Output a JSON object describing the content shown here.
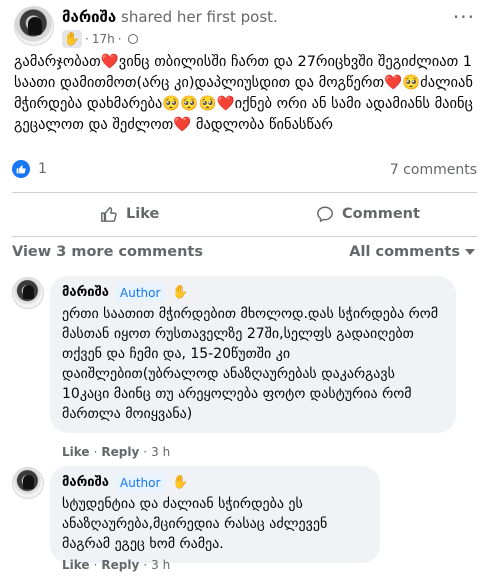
{
  "post": {
    "author": "მარიშა",
    "action": "shared her first post.",
    "time": "17h",
    "group_icon": "waving-hand-icon",
    "body": "გამარჯობათ❤️ვინც თბილისში ჩართ და 27რიცხვში შეგიძლიათ 1 საათი დამითმოთ(არც კი)დაპლიუსდით და მოგწერთ❤️🥺ძალიან მჭირდება დახმარება🥺🥺🥺❤️იქნებ ორი ან სამი ადამიანს მაინც გეცალოთ და შეძლოთ❤️ მადლობა წინასწარ",
    "reaction_count": "1",
    "comments_count": "7 comments",
    "like_label": "Like",
    "comment_label": "Comment"
  },
  "comments_section": {
    "view_more": "View 3 more comments",
    "filter": "All comments"
  },
  "comments": [
    {
      "name": "მარიშა",
      "badge": "Author",
      "text": "ერთი საათით მჭირდებით მხოლოდ.დას სჭირდება რომ მასთან იყოთ რუსთაველზე 27ში,სელფს გადაიღებთ თქვენ და ჩემი და, 15-20წუთში კი დაიშლებით(უბრალოდ ანაზღაურებას დაკარგავს 10კაცი მაინც თუ არეყოლება ფოტო დასტურია რომ მართლა მოიყვანა)",
      "like": "Like",
      "reply": "Reply",
      "time": "3 h"
    },
    {
      "name": "მარიშა",
      "badge": "Author",
      "text": "სტუდენტია და ძალიან სჭირდება ეს ანაზღაურება,მცირედია რასაც აძლევენ მაგრამ ეგეც ხომ რამეა.",
      "like": "Like",
      "reply": "Reply",
      "time": "3 h"
    }
  ],
  "colors": {
    "accent": "#1877f2",
    "secondary_text": "#65676b",
    "bubble": "#f0f2f5"
  }
}
